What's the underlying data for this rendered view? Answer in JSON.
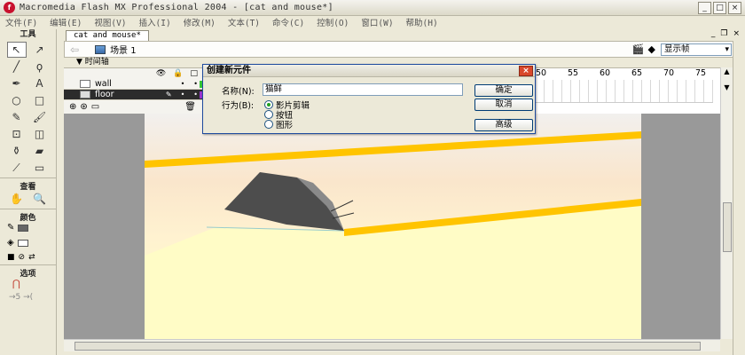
{
  "app": {
    "logo": "f",
    "title": "Macromedia Flash MX Professional 2004 - [cat and mouse*]",
    "controls": [
      "_",
      "□",
      "×"
    ]
  },
  "menu": [
    "文件(F)",
    "编辑(E)",
    "视图(V)",
    "插入(I)",
    "修改(M)",
    "文本(T)",
    "命令(C)",
    "控制(O)",
    "窗口(W)",
    "帮助(H)"
  ],
  "tools": {
    "header": "工具",
    "view_header": "查看",
    "color_header": "颜色",
    "options_header": "选项",
    "items": [
      {
        "name": "arrow-tool-icon",
        "glyph": "↖"
      },
      {
        "name": "subselect-tool-icon",
        "glyph": "↗"
      },
      {
        "name": "line-tool-icon",
        "glyph": "╱"
      },
      {
        "name": "lasso-tool-icon",
        "glyph": "ϙ"
      },
      {
        "name": "pen-tool-icon",
        "glyph": "✒"
      },
      {
        "name": "text-tool-icon",
        "glyph": "A"
      },
      {
        "name": "oval-tool-icon",
        "glyph": "○"
      },
      {
        "name": "rectangle-tool-icon",
        "glyph": "□"
      },
      {
        "name": "pencil-tool-icon",
        "glyph": "✎"
      },
      {
        "name": "brush-tool-icon",
        "glyph": "🖌"
      },
      {
        "name": "free-transform-tool-icon",
        "glyph": "⊡"
      },
      {
        "name": "fill-transform-tool-icon",
        "glyph": "◫"
      },
      {
        "name": "ink-bottle-tool-icon",
        "glyph": "⚱"
      },
      {
        "name": "paint-bucket-tool-icon",
        "glyph": "▰"
      },
      {
        "name": "eyedropper-tool-icon",
        "glyph": "⟋"
      },
      {
        "name": "eraser-tool-icon",
        "glyph": "▭"
      }
    ]
  },
  "document": {
    "tab": "cat and mouse*",
    "doc_controls": [
      "_",
      "❐",
      "×"
    ],
    "scene_label": "场景 1",
    "zoom": "显示帧"
  },
  "timeline": {
    "header": "▼ 时间轴",
    "layers": [
      {
        "name": "wall",
        "selected": false,
        "color": "#35c635"
      },
      {
        "name": "floor",
        "selected": true,
        "color": "#9933cc"
      }
    ],
    "ruler": [
      "50",
      "55",
      "60",
      "65",
      "70",
      "75"
    ]
  },
  "dialog": {
    "title": "创建新元件",
    "name_label": "名称(N):",
    "name_value": "猫鲜",
    "behavior_label": "行为(B):",
    "options": [
      {
        "label": "影片剪辑",
        "checked": true
      },
      {
        "label": "按钮",
        "checked": false
      },
      {
        "label": "图形",
        "checked": false
      }
    ],
    "ok": "确定",
    "cancel": "取消",
    "advanced": "高级",
    "close": "×"
  },
  "colors": {
    "stripe": "#ffc400",
    "mouse_dark": "#4d4d4d",
    "mouse_light": "#8a8a8a"
  }
}
